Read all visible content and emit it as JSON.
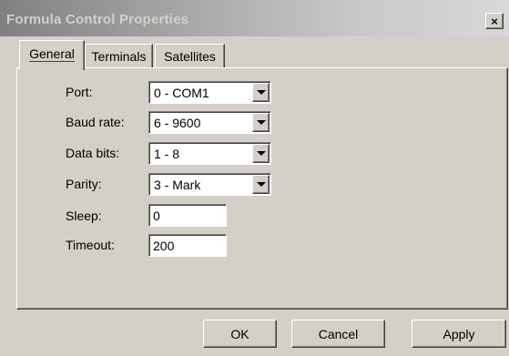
{
  "window": {
    "title": "Formula Control Properties",
    "close_label": "×"
  },
  "tabs": [
    {
      "label": "General",
      "active": true
    },
    {
      "label": "Terminals",
      "active": false
    },
    {
      "label": "Satellites",
      "active": false
    }
  ],
  "general": {
    "port": {
      "label": "Port:",
      "value": "0 - COM1"
    },
    "baud_rate": {
      "label": "Baud rate:",
      "value": "6 - 9600"
    },
    "data_bits": {
      "label": "Data bits:",
      "value": "1 - 8"
    },
    "parity": {
      "label": "Parity:",
      "value": "3 - Mark"
    },
    "sleep": {
      "label": "Sleep:",
      "value": "0"
    },
    "timeout": {
      "label": "Timeout:",
      "value": "200"
    }
  },
  "buttons": {
    "ok": "OK",
    "cancel": "Cancel",
    "apply": "Apply"
  },
  "colors": {
    "face": "#d4d0c8",
    "title_gradient_start": "#808080",
    "title_gradient_end": "#d8d8d8",
    "title_text": "#d4d0c8"
  },
  "icons": {
    "close": "close-icon",
    "dropdown": "chevron-down-icon"
  }
}
